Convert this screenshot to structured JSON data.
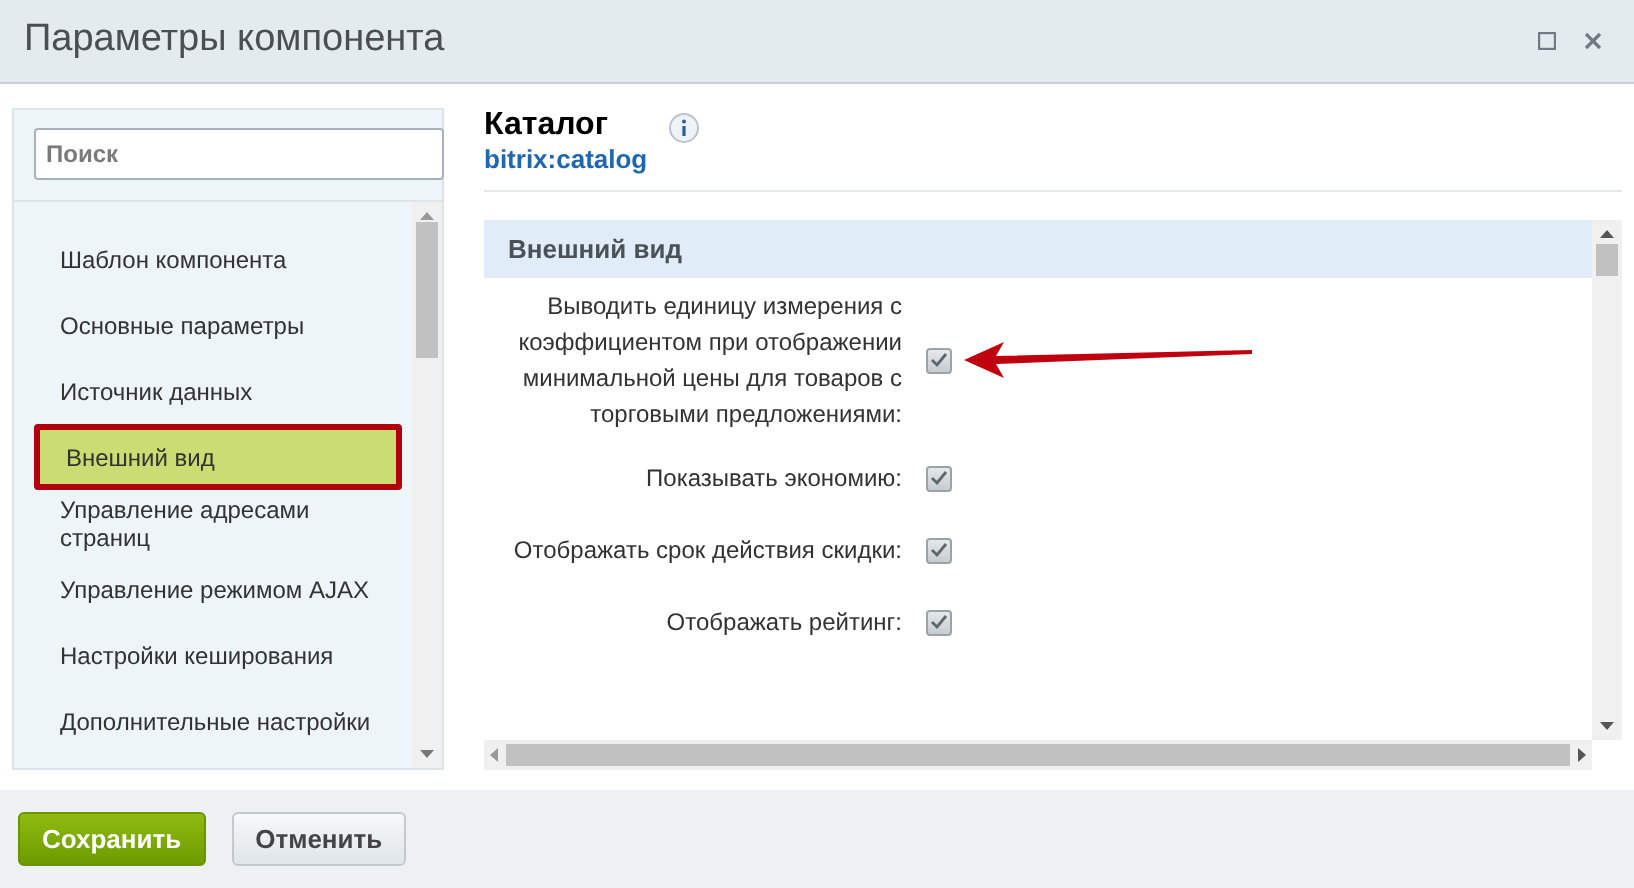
{
  "window": {
    "title": "Параметры компонента"
  },
  "search": {
    "placeholder": "Поиск"
  },
  "sidebar": {
    "items": [
      {
        "label": "Шаблон компонента",
        "selected": false
      },
      {
        "label": "Основные параметры",
        "selected": false
      },
      {
        "label": "Источник данных",
        "selected": false
      },
      {
        "label": "Внешний вид",
        "selected": true
      },
      {
        "label": "Управление адресами страниц",
        "selected": false
      },
      {
        "label": "Управление режимом AJAX",
        "selected": false
      },
      {
        "label": "Настройки кеширования",
        "selected": false
      },
      {
        "label": "Дополнительные настройки",
        "selected": false
      }
    ]
  },
  "component": {
    "title": "Каталог",
    "code": "bitrix:catalog"
  },
  "section": {
    "title": "Внешний вид",
    "params": [
      {
        "label": "Выводить единицу измерения с коэффициентом при отображении минимальной цены для товаров с торговыми предложениями:",
        "checked": true,
        "annotated": true
      },
      {
        "label": "Показывать экономию:",
        "checked": true,
        "annotated": false
      },
      {
        "label": "Отображать срок действия скидки:",
        "checked": true,
        "annotated": false
      },
      {
        "label": "Отображать рейтинг:",
        "checked": true,
        "annotated": false
      }
    ]
  },
  "buttons": [
    {
      "label": "Сохранить",
      "kind": "primary"
    },
    {
      "label": "Отменить",
      "kind": "secondary"
    }
  ]
}
